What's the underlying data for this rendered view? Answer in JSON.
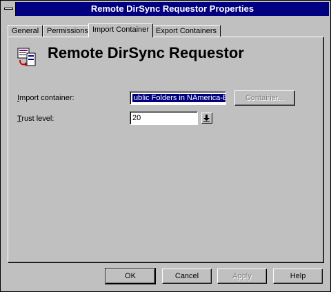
{
  "window": {
    "title": "Remote DirSync Requestor Properties"
  },
  "tabs": [
    {
      "label": "General"
    },
    {
      "label": "Permissions"
    },
    {
      "label": "Import Container"
    },
    {
      "label": "Export Containers"
    }
  ],
  "page": {
    "heading": "Remote DirSync Requestor",
    "icon": "dirsync-requestor-icon"
  },
  "form": {
    "import_container_label_prefix": "I",
    "import_container_label_rest": "mport container:",
    "import_container_value": "ublic Folders in NAmerica-E",
    "container_button": "Container...",
    "trust_level_label_prefix": "T",
    "trust_level_label_rest": "rust level:",
    "trust_level_value": "20",
    "spinner_icon": "spin-down-icon"
  },
  "buttons": {
    "ok": "OK",
    "cancel": "Cancel",
    "apply": "Apply",
    "help": "Help"
  },
  "colors": {
    "titlebar": "#000080",
    "face": "#c0c0c0",
    "selection": "#000080"
  }
}
